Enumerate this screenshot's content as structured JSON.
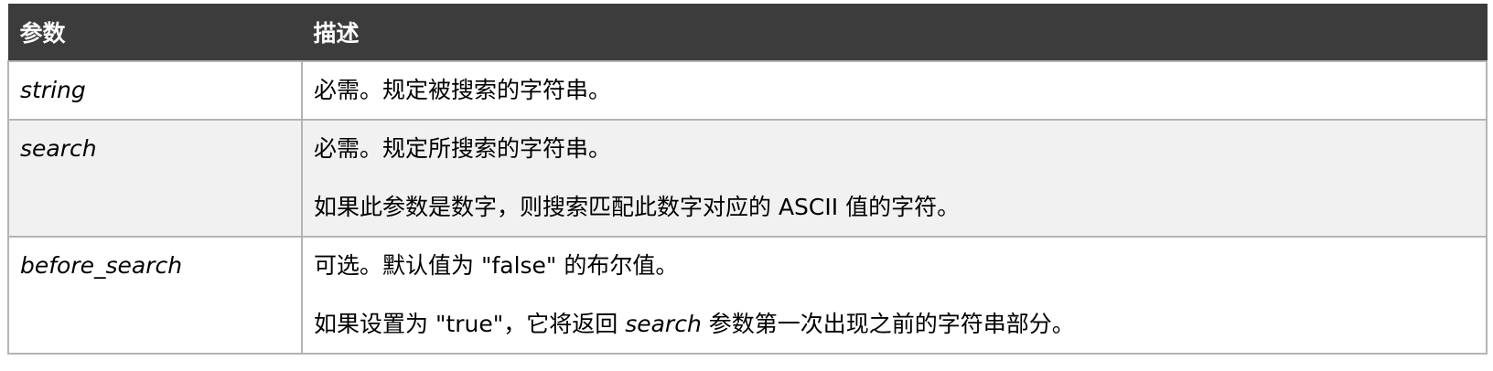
{
  "header": {
    "col_param": "参数",
    "col_desc": "描述"
  },
  "rows": [
    {
      "param": "string",
      "desc_lines": [
        "必需。规定被搜索的字符串。"
      ]
    },
    {
      "param": "search",
      "desc_lines": [
        "必需。规定所搜索的字符串。",
        "如果此参数是数字，则搜索匹配此数字对应的 ASCII 值的字符。"
      ]
    },
    {
      "param": "before_search",
      "desc_line1": "可选。默认值为 \"false\" 的布尔值。",
      "desc_line2_pre": "如果设置为 \"true\"，它将返回 ",
      "desc_line2_italic": "search",
      "desc_line2_post": " 参数第一次出现之前的字符串部分。"
    }
  ]
}
